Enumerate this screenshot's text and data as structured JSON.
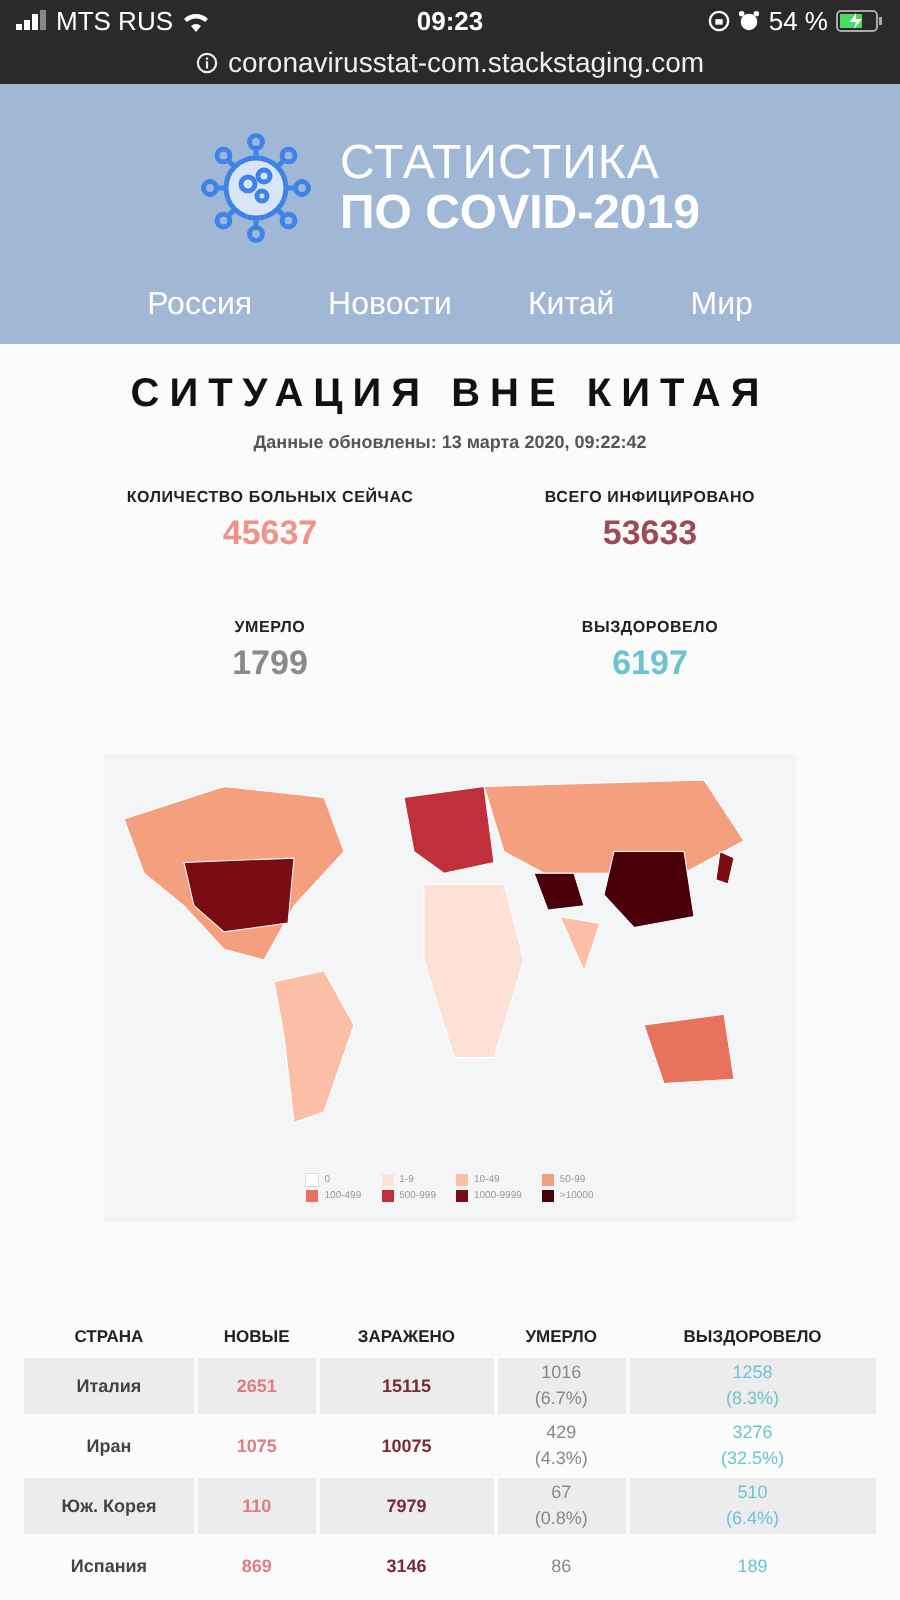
{
  "status_bar": {
    "carrier": "MTS RUS",
    "time": "09:23",
    "battery": "54 %"
  },
  "url_bar": {
    "url": "coronavirusstat-com.stackstaging.com"
  },
  "header": {
    "title_line1": "СТАТИСТИКА",
    "title_line2": "ПО COVID-2019",
    "nav": [
      {
        "label": "Россия"
      },
      {
        "label": "Новости"
      },
      {
        "label": "Китай"
      },
      {
        "label": "Мир"
      }
    ]
  },
  "heading": "СИТУАЦИЯ ВНЕ КИТАЯ",
  "updated": "Данные обновлены: 13 марта 2020, 09:22:42",
  "stats": [
    {
      "label": "КОЛИЧЕСТВО БОЛЬНЫХ СЕЙЧАС",
      "value": "45637",
      "color": "#f0928a"
    },
    {
      "label": "ВСЕГО ИНФИЦИРОВАНО",
      "value": "53633",
      "color": "#9c4a55"
    },
    {
      "label": "УМЕРЛО",
      "value": "1799",
      "color": "#8a8a8a"
    },
    {
      "label": "ВЫЗДОРОВЕЛО",
      "value": "6197",
      "color": "#6cc4d0"
    }
  ],
  "map": {
    "legend": [
      {
        "label": "0",
        "color": "#ffffff"
      },
      {
        "label": "1-9",
        "color": "#fde0d6"
      },
      {
        "label": "10-49",
        "color": "#fbbfa8"
      },
      {
        "label": "50-99",
        "color": "#f4a07e"
      },
      {
        "label": "100-499",
        "color": "#e8725c"
      },
      {
        "label": "500-999",
        "color": "#c0303a"
      },
      {
        "label": "1000-9999",
        "color": "#7a0c14"
      },
      {
        "label": ">10000",
        "color": "#4a0008"
      }
    ]
  },
  "table": {
    "columns": [
      "СТРАНА",
      "НОВЫЕ",
      "ЗАРАЖЕНО",
      "УМЕРЛО",
      "ВЫЗДОРОВЕЛО"
    ],
    "rows": [
      {
        "country": "Италия",
        "new": "2651",
        "infected": "15115",
        "died": "1016",
        "died_pct": "(6.7%)",
        "recovered": "1258",
        "recovered_pct": "(8.3%)"
      },
      {
        "country": "Иран",
        "new": "1075",
        "infected": "10075",
        "died": "429",
        "died_pct": "(4.3%)",
        "recovered": "3276",
        "recovered_pct": "(32.5%)"
      },
      {
        "country": "Юж. Корея",
        "new": "110",
        "infected": "7979",
        "died": "67",
        "died_pct": "(0.8%)",
        "recovered": "510",
        "recovered_pct": "(6.4%)"
      },
      {
        "country": "Испания",
        "new": "869",
        "infected": "3146",
        "died": "86",
        "recovered": "189"
      }
    ]
  }
}
